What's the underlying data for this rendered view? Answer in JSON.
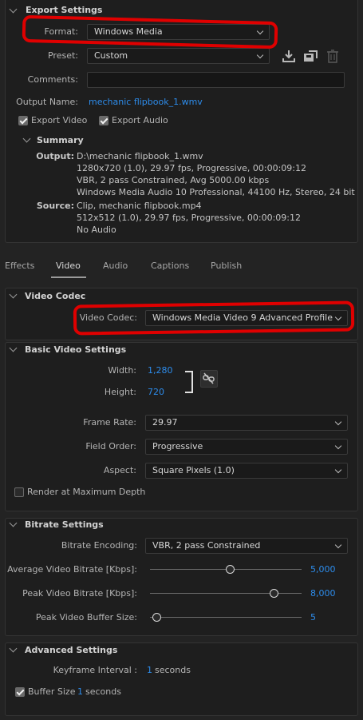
{
  "export_settings": {
    "header": "Export Settings",
    "format_label": "Format:",
    "format_value": "Windows Media",
    "preset_label": "Preset:",
    "preset_value": "Custom",
    "comments_label": "Comments:",
    "comments_value": "",
    "output_name_label": "Output Name:",
    "output_name_value": "mechanic flipbook_1.wmv",
    "export_video_label": "Export Video",
    "export_video_checked": true,
    "export_audio_label": "Export Audio",
    "export_audio_checked": true
  },
  "summary": {
    "header": "Summary",
    "output_label": "Output:",
    "output_lines": [
      "D:\\mechanic flipbook_1.wmv",
      "1280x720 (1.0), 29.97 fps, Progressive, 00:00:09:12",
      "VBR, 2 pass Constrained, Avg 5000.00 kbps",
      "Windows Media Audio 10 Professional, 44100 Hz, Stereo, 24 bit"
    ],
    "source_label": "Source:",
    "source_lines": [
      "Clip, mechanic flipbook.mp4",
      "512x512 (1.0), 29.97 fps, Progressive, 00:00:09:12",
      "No Audio"
    ]
  },
  "tabs": [
    "Effects",
    "Video",
    "Audio",
    "Captions",
    "Publish"
  ],
  "active_tab": "Video",
  "video_codec": {
    "header": "Video Codec",
    "label": "Video Codec:",
    "value": "Windows Media Video 9 Advanced Profile"
  },
  "basic_video": {
    "header": "Basic Video Settings",
    "width_label": "Width:",
    "width_value": "1,280",
    "height_label": "Height:",
    "height_value": "720",
    "frame_rate_label": "Frame Rate:",
    "frame_rate_value": "29.97",
    "field_order_label": "Field Order:",
    "field_order_value": "Progressive",
    "aspect_label": "Aspect:",
    "aspect_value": "Square Pixels (1.0)",
    "render_max_depth_label": "Render at Maximum Depth",
    "render_max_depth_checked": false
  },
  "bitrate": {
    "header": "Bitrate Settings",
    "encoding_label": "Bitrate Encoding:",
    "encoding_value": "VBR, 2 pass Constrained",
    "avg_label": "Average Video Bitrate [Kbps]:",
    "avg_value": "5,000",
    "avg_fraction": 0.5,
    "peak_label": "Peak Video Bitrate [Kbps]:",
    "peak_value": "8,000",
    "peak_fraction": 0.8,
    "buffer_label": "Peak Video Buffer Size:",
    "buffer_value": "5",
    "buffer_fraction": 0.0
  },
  "advanced": {
    "header": "Advanced Settings",
    "keyframe_label": "Keyframe Interval :",
    "keyframe_value": "1",
    "keyframe_unit": "seconds",
    "buffer_label": "Buffer Size",
    "buffer_checked": true,
    "buffer_value": "1",
    "buffer_unit": "seconds"
  },
  "colors": {
    "background": "#232323",
    "panel": "#1e1e1e",
    "link_blue": "#2d8ceb",
    "annotation_red": "#e00000"
  }
}
